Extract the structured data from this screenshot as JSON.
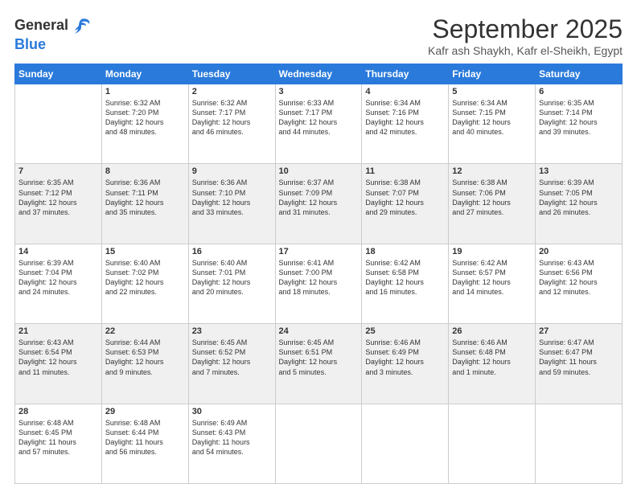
{
  "header": {
    "logo_general": "General",
    "logo_blue": "Blue",
    "month_title": "September 2025",
    "subtitle": "Kafr ash Shaykh, Kafr el-Sheikh, Egypt"
  },
  "days_of_week": [
    "Sunday",
    "Monday",
    "Tuesday",
    "Wednesday",
    "Thursday",
    "Friday",
    "Saturday"
  ],
  "weeks": [
    [
      {
        "day": "",
        "content": ""
      },
      {
        "day": "1",
        "content": "Sunrise: 6:32 AM\nSunset: 7:20 PM\nDaylight: 12 hours\nand 48 minutes."
      },
      {
        "day": "2",
        "content": "Sunrise: 6:32 AM\nSunset: 7:17 PM\nDaylight: 12 hours\nand 46 minutes."
      },
      {
        "day": "3",
        "content": "Sunrise: 6:33 AM\nSunset: 7:17 PM\nDaylight: 12 hours\nand 44 minutes."
      },
      {
        "day": "4",
        "content": "Sunrise: 6:34 AM\nSunset: 7:16 PM\nDaylight: 12 hours\nand 42 minutes."
      },
      {
        "day": "5",
        "content": "Sunrise: 6:34 AM\nSunset: 7:15 PM\nDaylight: 12 hours\nand 40 minutes."
      },
      {
        "day": "6",
        "content": "Sunrise: 6:35 AM\nSunset: 7:14 PM\nDaylight: 12 hours\nand 39 minutes."
      }
    ],
    [
      {
        "day": "7",
        "content": "Sunrise: 6:35 AM\nSunset: 7:12 PM\nDaylight: 12 hours\nand 37 minutes."
      },
      {
        "day": "8",
        "content": "Sunrise: 6:36 AM\nSunset: 7:11 PM\nDaylight: 12 hours\nand 35 minutes."
      },
      {
        "day": "9",
        "content": "Sunrise: 6:36 AM\nSunset: 7:10 PM\nDaylight: 12 hours\nand 33 minutes."
      },
      {
        "day": "10",
        "content": "Sunrise: 6:37 AM\nSunset: 7:09 PM\nDaylight: 12 hours\nand 31 minutes."
      },
      {
        "day": "11",
        "content": "Sunrise: 6:38 AM\nSunset: 7:07 PM\nDaylight: 12 hours\nand 29 minutes."
      },
      {
        "day": "12",
        "content": "Sunrise: 6:38 AM\nSunset: 7:06 PM\nDaylight: 12 hours\nand 27 minutes."
      },
      {
        "day": "13",
        "content": "Sunrise: 6:39 AM\nSunset: 7:05 PM\nDaylight: 12 hours\nand 26 minutes."
      }
    ],
    [
      {
        "day": "14",
        "content": "Sunrise: 6:39 AM\nSunset: 7:04 PM\nDaylight: 12 hours\nand 24 minutes."
      },
      {
        "day": "15",
        "content": "Sunrise: 6:40 AM\nSunset: 7:02 PM\nDaylight: 12 hours\nand 22 minutes."
      },
      {
        "day": "16",
        "content": "Sunrise: 6:40 AM\nSunset: 7:01 PM\nDaylight: 12 hours\nand 20 minutes."
      },
      {
        "day": "17",
        "content": "Sunrise: 6:41 AM\nSunset: 7:00 PM\nDaylight: 12 hours\nand 18 minutes."
      },
      {
        "day": "18",
        "content": "Sunrise: 6:42 AM\nSunset: 6:58 PM\nDaylight: 12 hours\nand 16 minutes."
      },
      {
        "day": "19",
        "content": "Sunrise: 6:42 AM\nSunset: 6:57 PM\nDaylight: 12 hours\nand 14 minutes."
      },
      {
        "day": "20",
        "content": "Sunrise: 6:43 AM\nSunset: 6:56 PM\nDaylight: 12 hours\nand 12 minutes."
      }
    ],
    [
      {
        "day": "21",
        "content": "Sunrise: 6:43 AM\nSunset: 6:54 PM\nDaylight: 12 hours\nand 11 minutes."
      },
      {
        "day": "22",
        "content": "Sunrise: 6:44 AM\nSunset: 6:53 PM\nDaylight: 12 hours\nand 9 minutes."
      },
      {
        "day": "23",
        "content": "Sunrise: 6:45 AM\nSunset: 6:52 PM\nDaylight: 12 hours\nand 7 minutes."
      },
      {
        "day": "24",
        "content": "Sunrise: 6:45 AM\nSunset: 6:51 PM\nDaylight: 12 hours\nand 5 minutes."
      },
      {
        "day": "25",
        "content": "Sunrise: 6:46 AM\nSunset: 6:49 PM\nDaylight: 12 hours\nand 3 minutes."
      },
      {
        "day": "26",
        "content": "Sunrise: 6:46 AM\nSunset: 6:48 PM\nDaylight: 12 hours\nand 1 minute."
      },
      {
        "day": "27",
        "content": "Sunrise: 6:47 AM\nSunset: 6:47 PM\nDaylight: 11 hours\nand 59 minutes."
      }
    ],
    [
      {
        "day": "28",
        "content": "Sunrise: 6:48 AM\nSunset: 6:45 PM\nDaylight: 11 hours\nand 57 minutes."
      },
      {
        "day": "29",
        "content": "Sunrise: 6:48 AM\nSunset: 6:44 PM\nDaylight: 11 hours\nand 56 minutes."
      },
      {
        "day": "30",
        "content": "Sunrise: 6:49 AM\nSunset: 6:43 PM\nDaylight: 11 hours\nand 54 minutes."
      },
      {
        "day": "",
        "content": ""
      },
      {
        "day": "",
        "content": ""
      },
      {
        "day": "",
        "content": ""
      },
      {
        "day": "",
        "content": ""
      }
    ]
  ]
}
